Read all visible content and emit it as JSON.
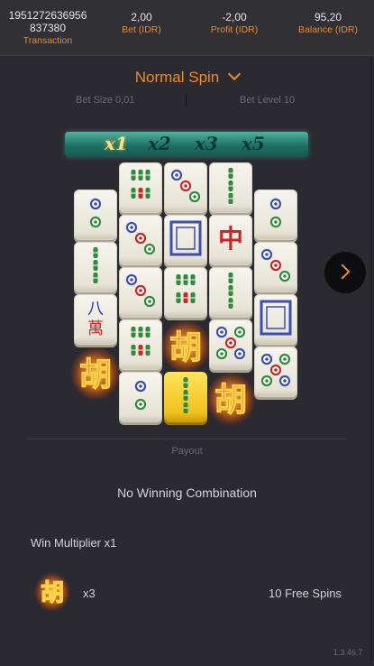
{
  "header": {
    "transaction": {
      "value": "1951272636956837380",
      "value_line1": "1951272636956",
      "value_line2": "837380",
      "label": "Transaction"
    },
    "bet": {
      "value": "2,00",
      "label": "Bet (IDR)"
    },
    "profit": {
      "value": "-2,00",
      "label": "Profit (IDR)"
    },
    "balance": {
      "value": "95,20",
      "label": "Balance (IDR)"
    }
  },
  "spin": {
    "title": "Normal Spin",
    "bet_size": "Bet Size 0,01",
    "bet_level": "Bet Level 10"
  },
  "multipliers": [
    "x1",
    "x2",
    "x3",
    "x5"
  ],
  "active_multiplier": "x1",
  "reels": {
    "symbols": [
      [
        "circle-2",
        "bamboo-3",
        "wan-8",
        "hu",
        null
      ],
      [
        "bamboo-6",
        "circle-3",
        "circle-3",
        "bamboo-6",
        "circle-2"
      ],
      [
        "circle-3",
        "white-dragon",
        "bamboo-6",
        "hu",
        "bamboo-3-gold"
      ],
      [
        "bamboo-3",
        "red-dragon",
        "bamboo-3",
        "circle-5",
        "hu"
      ],
      [
        "circle-2",
        "circle-3",
        "white-dragon",
        "circle-5",
        null
      ]
    ],
    "dragon_glyph": "中",
    "wan_top": "八",
    "wan_bottom": "萬",
    "hu_glyph": "胡"
  },
  "payout": {
    "label": "Payout",
    "result": "No Winning Combination",
    "win_multiplier": "Win Multiplier x1",
    "scatter_count": "x3",
    "free_spins": "10 Free Spins"
  },
  "version": "1.3.46.7",
  "colors": {
    "accent": "#f08a24",
    "background": "#2b2a30",
    "header": "#303035"
  }
}
